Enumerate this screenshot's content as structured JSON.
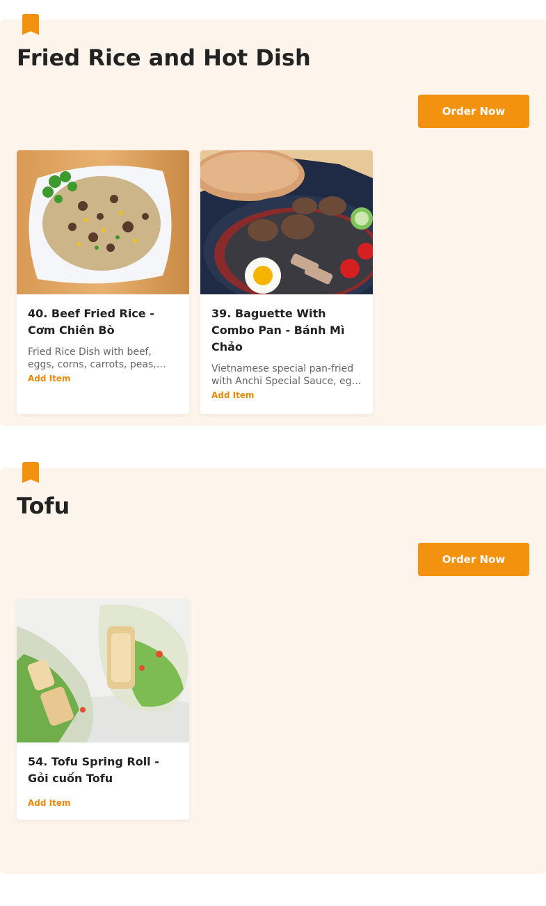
{
  "accent_color": "#f2920f",
  "section_bg": "#fdf5ec",
  "sections": [
    {
      "title": "Fried Rice and Hot Dish",
      "bookmark_icon": "bookmark-icon",
      "order_button": "Order Now",
      "items": [
        {
          "title": "40. Beef Fried Rice - Cơm Chiên Bò",
          "description": "Fried Rice Dish with beef, eggs, corns, carrots, peas, onions",
          "add_label": "Add Item",
          "image": "beef-fried-rice-photo"
        },
        {
          "title": "39. Baguette With Combo Pan - Bánh Mì Chảo",
          "description": "Vietnamese special pan-fried with Anchi Special Sauce, egg, pate",
          "add_label": "Add Item",
          "image": "baguette-combo-pan-photo"
        }
      ]
    },
    {
      "title": "Tofu",
      "bookmark_icon": "bookmark-icon",
      "order_button": "Order Now",
      "items": [
        {
          "title": "54. Tofu Spring Roll - Gỏi cuốn Tofu",
          "description": "",
          "add_label": "Add Item",
          "image": "tofu-spring-roll-photo"
        }
      ]
    }
  ]
}
